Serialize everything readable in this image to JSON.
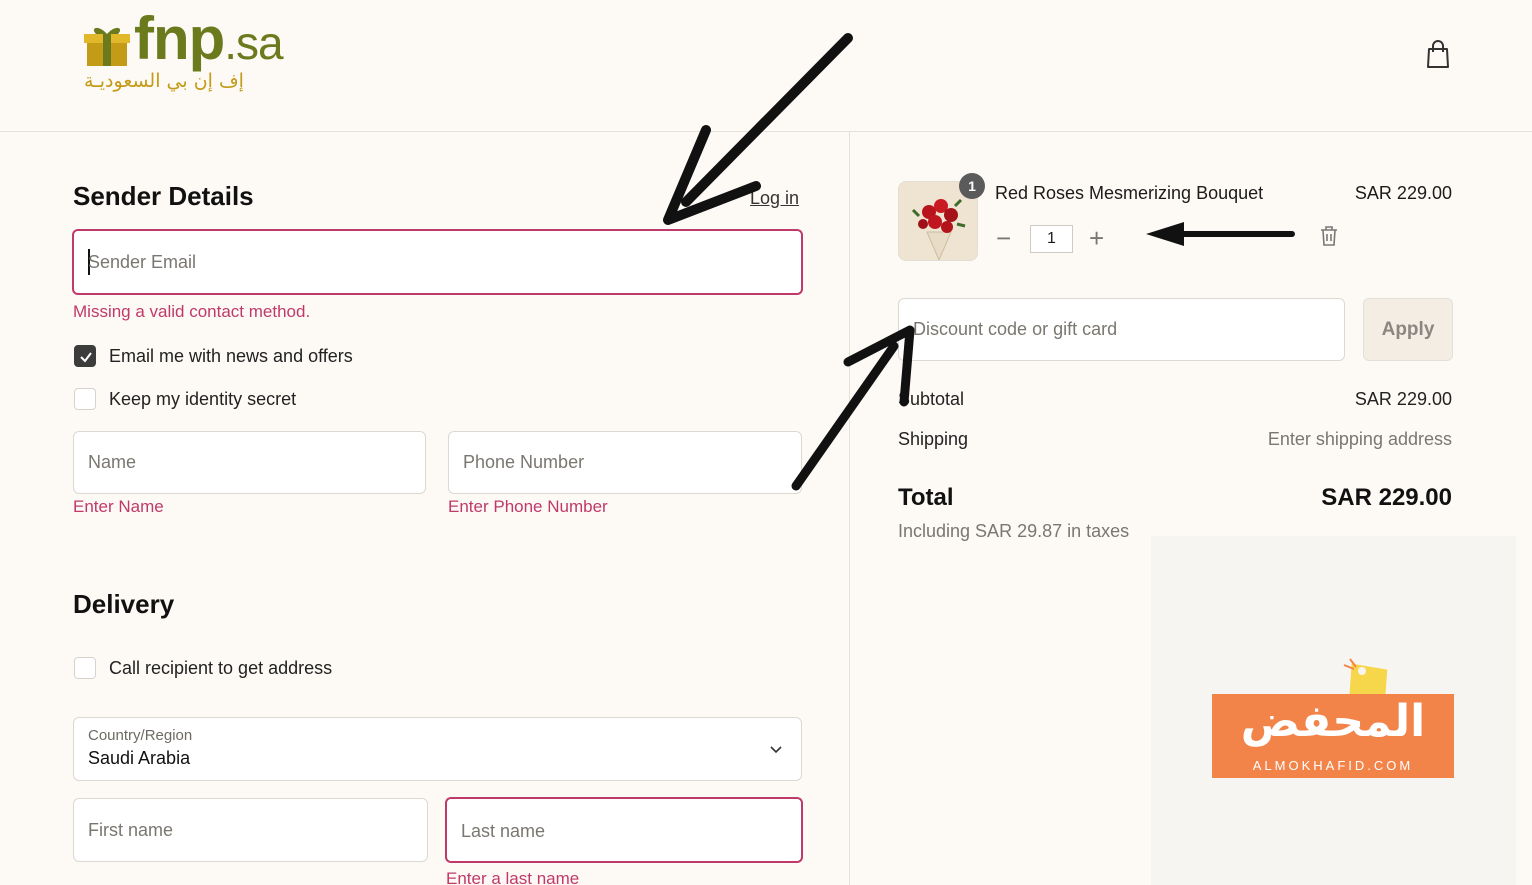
{
  "header": {
    "logo_en": "fnp",
    "logo_en_suffix": ".sa",
    "logo_ar": "إف إن بي السعوديـة",
    "cart_icon": "shopping-bag-icon"
  },
  "sender": {
    "title": "Sender Details",
    "login_label": "Log in",
    "email_placeholder": "Sender Email",
    "email_error": "Missing a valid contact method.",
    "news_label": "Email me with news and offers",
    "news_checked": true,
    "secret_label": "Keep my identity secret",
    "secret_checked": false,
    "name_placeholder": "Name",
    "name_error": "Enter Name",
    "phone_placeholder": "Phone Number",
    "phone_error": "Enter Phone Number"
  },
  "delivery": {
    "title": "Delivery",
    "call_label": "Call recipient to get address",
    "call_checked": false,
    "country_label": "Country/Region",
    "country_value": "Saudi Arabia",
    "first_name_placeholder": "First name",
    "last_name_placeholder": "Last name",
    "last_name_error": "Enter a last name"
  },
  "summary": {
    "item": {
      "name": "Red Roses Mesmerizing Bouquet",
      "price": "SAR 229.00",
      "badge": "1",
      "quantity": "1",
      "minus": "−",
      "plus": "+"
    },
    "discount_placeholder": "Discount code or gift card",
    "apply_label": "Apply",
    "subtotal_label": "Subtotal",
    "subtotal_value": "SAR 229.00",
    "shipping_label": "Shipping",
    "shipping_value": "Enter shipping address",
    "total_label": "Total",
    "total_value": "SAR 229.00",
    "tax_note": "Including SAR 29.87 in taxes"
  },
  "watermark": {
    "ar": "المحفض",
    "en": "ALMOKHAFID.COM"
  },
  "colors": {
    "error": "#c0396b",
    "logo_green": "#6a7a1c",
    "logo_gold": "#c39b16",
    "watermark_orange": "#f2844a"
  }
}
